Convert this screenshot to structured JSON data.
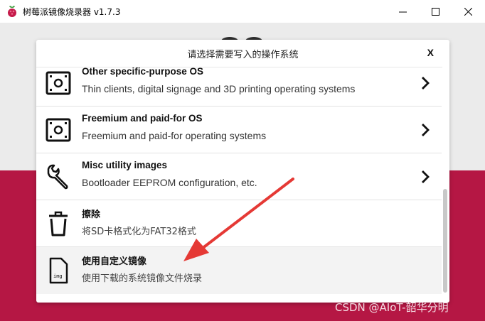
{
  "window": {
    "title": "树莓派镜像烧录器 v1.7.3",
    "controls": {
      "minimize": "—",
      "maximize": "☐",
      "close": "✕"
    }
  },
  "dialog": {
    "title": "请选择需要写入的操作系统",
    "close_label": "X",
    "items": [
      {
        "title": "Other specific-purpose OS",
        "description": "Thin clients, digital signage and 3D printing operating systems",
        "icon": "board-icon",
        "has_submenu": true
      },
      {
        "title": "Freemium and paid-for OS",
        "description": "Freemium and paid-for operating systems",
        "icon": "board-icon",
        "has_submenu": true
      },
      {
        "title": "Misc utility images",
        "description": "Bootloader EEPROM configuration, etc.",
        "icon": "wrench-icon",
        "has_submenu": true
      },
      {
        "title": "擦除",
        "description": "将SD卡格式化为FAT32格式",
        "icon": "trash-icon",
        "has_submenu": false
      },
      {
        "title": "使用自定义镜像",
        "description": "使用下载的系统镜像文件烧录",
        "icon": "img-file-icon",
        "icon_label": "img",
        "has_submenu": false,
        "selected": true
      }
    ]
  },
  "colors": {
    "brand_red": "#c51a4a",
    "annotation_red": "#e53935"
  },
  "watermark": "CSDN @AIoT-韶华分明"
}
